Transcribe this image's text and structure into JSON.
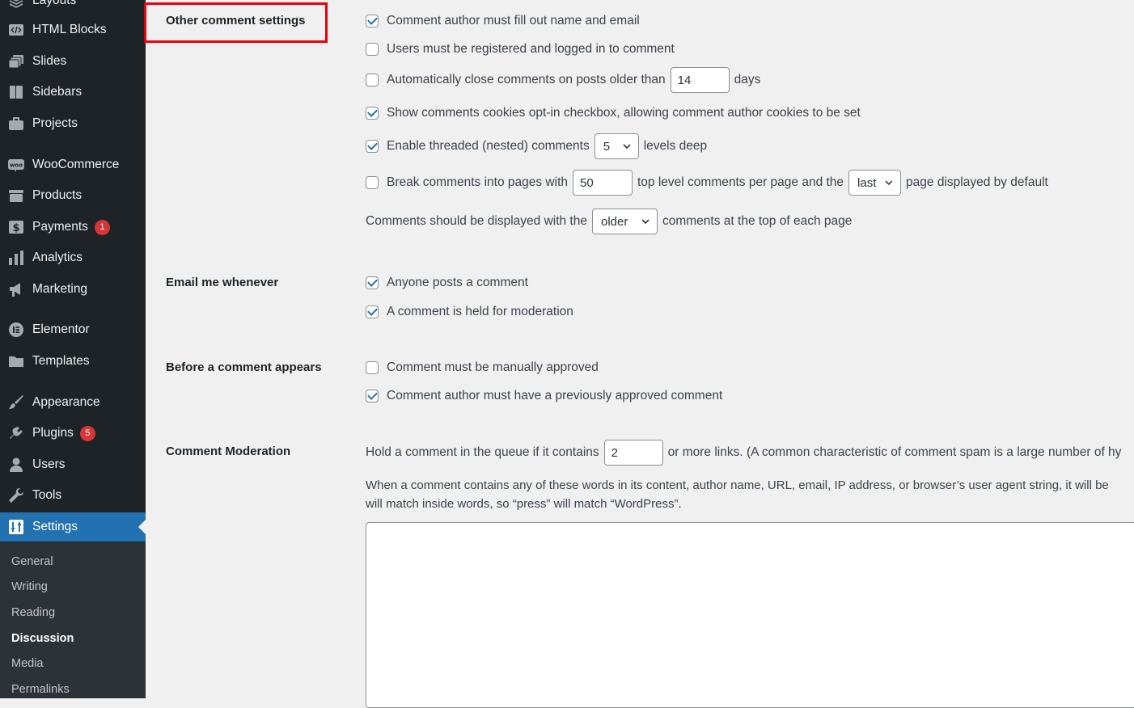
{
  "sidebar": {
    "items": [
      {
        "label": "Layouts",
        "icon": "layouts-icon"
      },
      {
        "label": "HTML Blocks",
        "icon": "html-blocks-icon"
      },
      {
        "label": "Slides",
        "icon": "slides-icon"
      },
      {
        "label": "Sidebars",
        "icon": "sidebars-icon"
      },
      {
        "label": "Projects",
        "icon": "projects-icon"
      },
      {
        "label": "WooCommerce",
        "icon": "woocommerce-icon"
      },
      {
        "label": "Products",
        "icon": "products-icon"
      },
      {
        "label": "Payments",
        "icon": "payments-icon",
        "badge": "1"
      },
      {
        "label": "Analytics",
        "icon": "analytics-icon"
      },
      {
        "label": "Marketing",
        "icon": "marketing-icon"
      },
      {
        "label": "Elementor",
        "icon": "elementor-icon"
      },
      {
        "label": "Templates",
        "icon": "templates-icon"
      },
      {
        "label": "Appearance",
        "icon": "appearance-icon"
      },
      {
        "label": "Plugins",
        "icon": "plugins-icon",
        "badge": "5"
      },
      {
        "label": "Users",
        "icon": "users-icon"
      },
      {
        "label": "Tools",
        "icon": "tools-icon"
      },
      {
        "label": "Settings",
        "icon": "settings-icon"
      }
    ],
    "submenu": [
      "General",
      "Writing",
      "Reading",
      "Discussion",
      "Media",
      "Permalinks"
    ]
  },
  "other_comment_settings": {
    "label": "Other comment settings",
    "require_name_email": "Comment author must fill out name and email",
    "registration_required": "Users must be registered and logged in to comment",
    "close_comments_prefix": "Automatically close comments on posts older than",
    "close_comments_days": "14",
    "close_comments_suffix": "days",
    "cookies_opt_in": "Show comments cookies opt-in checkbox, allowing comment author cookies to be set",
    "threaded_prefix": "Enable threaded (nested) comments",
    "threaded_depth": "5",
    "threaded_suffix": "levels deep",
    "paged_prefix": "Break comments into pages with",
    "paged_per_page": "50",
    "paged_middle": "top level comments per page and the",
    "paged_default_page": "last",
    "paged_suffix": "page displayed by default",
    "order_prefix": "Comments should be displayed with the",
    "order_value": "older",
    "order_suffix": "comments at the top of each page"
  },
  "email_me": {
    "label": "Email me whenever",
    "anyone_posts": "Anyone posts a comment",
    "held_for_moderation": "A comment is held for moderation"
  },
  "before_appears": {
    "label": "Before a comment appears",
    "manual_approval": "Comment must be manually approved",
    "previously_approved": "Comment author must have a previously approved comment"
  },
  "moderation": {
    "label": "Comment Moderation",
    "links_prefix": "Hold a comment in the queue if it contains",
    "links_value": "2",
    "links_suffix": "or more links. (A common characteristic of comment spam is a large number of hy",
    "description_line1": "When a comment contains any of these words in its content, author name, URL, email, IP address, or browser’s user agent string, it will be",
    "description_line2": "will match inside words, so “press” will match “WordPress”.",
    "keys": ""
  },
  "colors": {
    "sidebar_bg": "#1d2327",
    "submenu_bg": "#2c3338",
    "accent": "#2271b1",
    "badge": "#d63638",
    "highlight": "#e8000b"
  }
}
